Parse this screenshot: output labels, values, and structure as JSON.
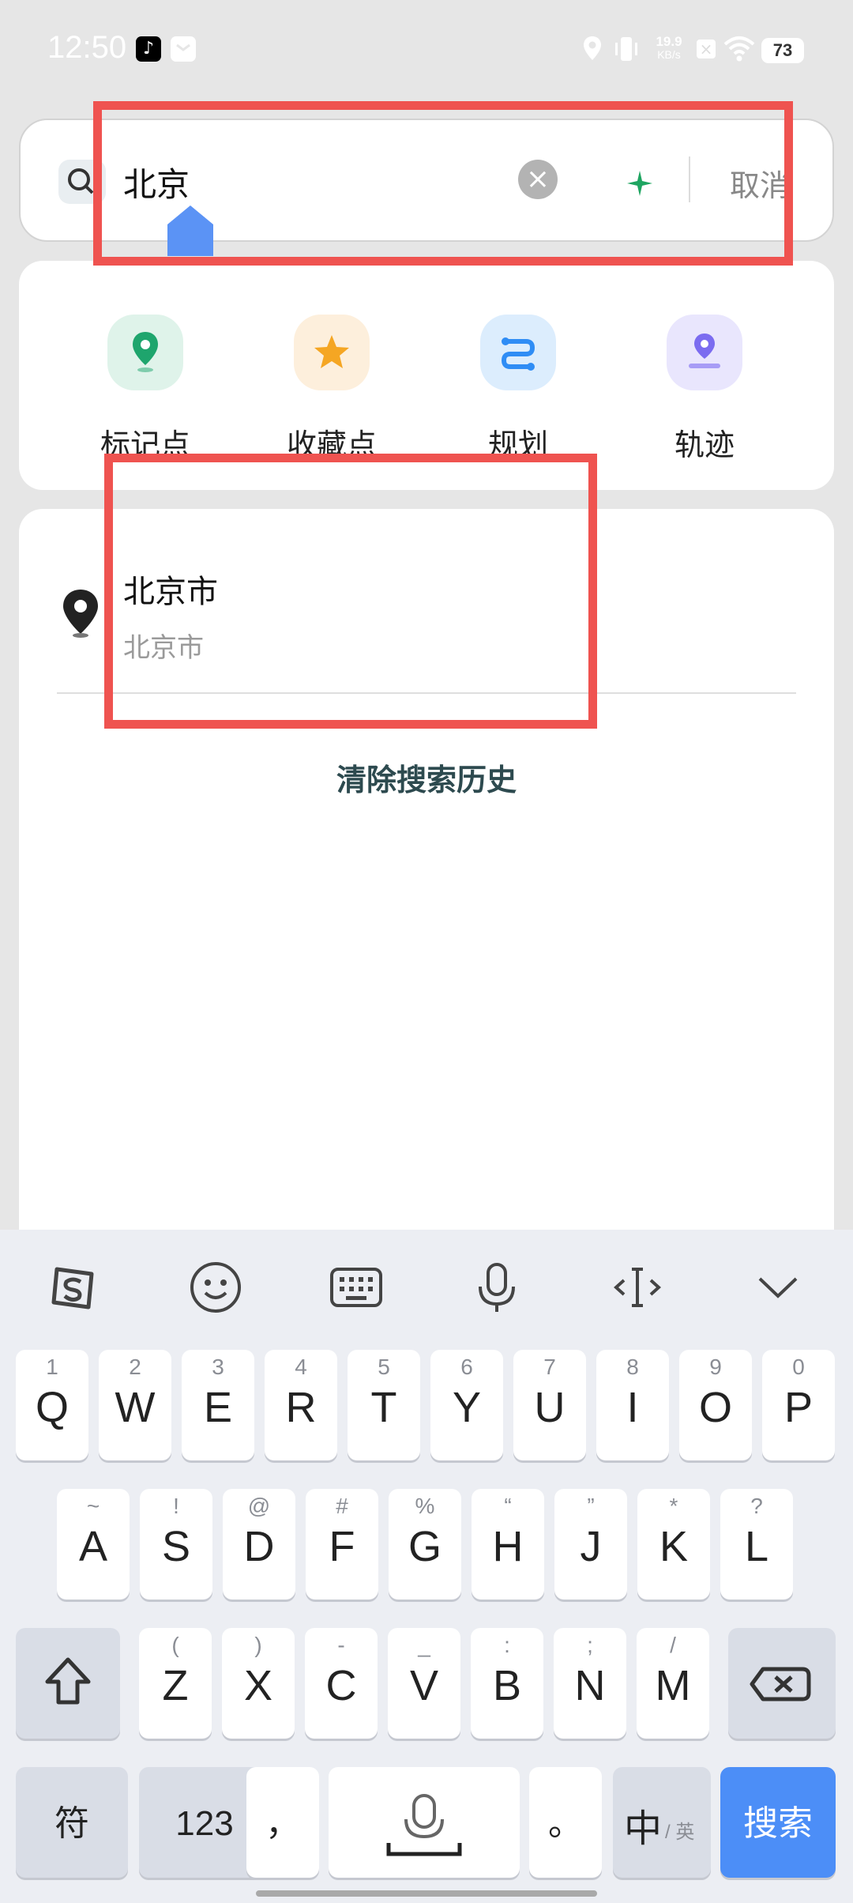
{
  "status_bar": {
    "time": "12:50",
    "net_speed_value": "19.9",
    "net_speed_unit": "KB/s",
    "battery": "73"
  },
  "search": {
    "query": "北京",
    "cancel_label": "取消"
  },
  "quick_actions": [
    {
      "label": "标记点",
      "icon": "marker-pin-icon",
      "color": "#1ea56d"
    },
    {
      "label": "收藏点",
      "icon": "star-icon",
      "color": "#f5a623"
    },
    {
      "label": "规划",
      "icon": "route-plan-icon",
      "color": "#2f8df5"
    },
    {
      "label": "轨迹",
      "icon": "track-icon",
      "color": "#7b6cf0"
    }
  ],
  "history": {
    "items": [
      {
        "title": "北京市",
        "subtitle": "北京市",
        "icon": "location-pin-icon"
      }
    ],
    "clear_label": "清除搜索历史"
  },
  "keyboard": {
    "toolbar": [
      "sogou-logo-icon",
      "emoji-icon",
      "keyboard-icon",
      "microphone-icon",
      "cursor-move-icon",
      "collapse-icon"
    ],
    "row1": [
      {
        "hint": "1",
        "key": "Q"
      },
      {
        "hint": "2",
        "key": "W"
      },
      {
        "hint": "3",
        "key": "E"
      },
      {
        "hint": "4",
        "key": "R"
      },
      {
        "hint": "5",
        "key": "T"
      },
      {
        "hint": "6",
        "key": "Y"
      },
      {
        "hint": "7",
        "key": "U"
      },
      {
        "hint": "8",
        "key": "I"
      },
      {
        "hint": "9",
        "key": "O"
      },
      {
        "hint": "0",
        "key": "P"
      }
    ],
    "row2": [
      {
        "hint": "~",
        "key": "A"
      },
      {
        "hint": "!",
        "key": "S"
      },
      {
        "hint": "@",
        "key": "D"
      },
      {
        "hint": "#",
        "key": "F"
      },
      {
        "hint": "%",
        "key": "G"
      },
      {
        "hint": "“",
        "key": "H"
      },
      {
        "hint": "”",
        "key": "J"
      },
      {
        "hint": "*",
        "key": "K"
      },
      {
        "hint": "?",
        "key": "L"
      }
    ],
    "row3": [
      {
        "hint": "(",
        "key": "Z"
      },
      {
        "hint": ")",
        "key": "X"
      },
      {
        "hint": "-",
        "key": "C"
      },
      {
        "hint": "_",
        "key": "V"
      },
      {
        "hint": ":",
        "key": "B"
      },
      {
        "hint": ";",
        "key": "N"
      },
      {
        "hint": "/",
        "key": "M"
      }
    ],
    "symbol_key": "符",
    "num_key": "123",
    "comma_key": "，",
    "period_key": "。",
    "lang_key_main": "中",
    "lang_key_sub": "/ 英",
    "search_key": "搜索",
    "accent_color": "#4c8ef7"
  }
}
